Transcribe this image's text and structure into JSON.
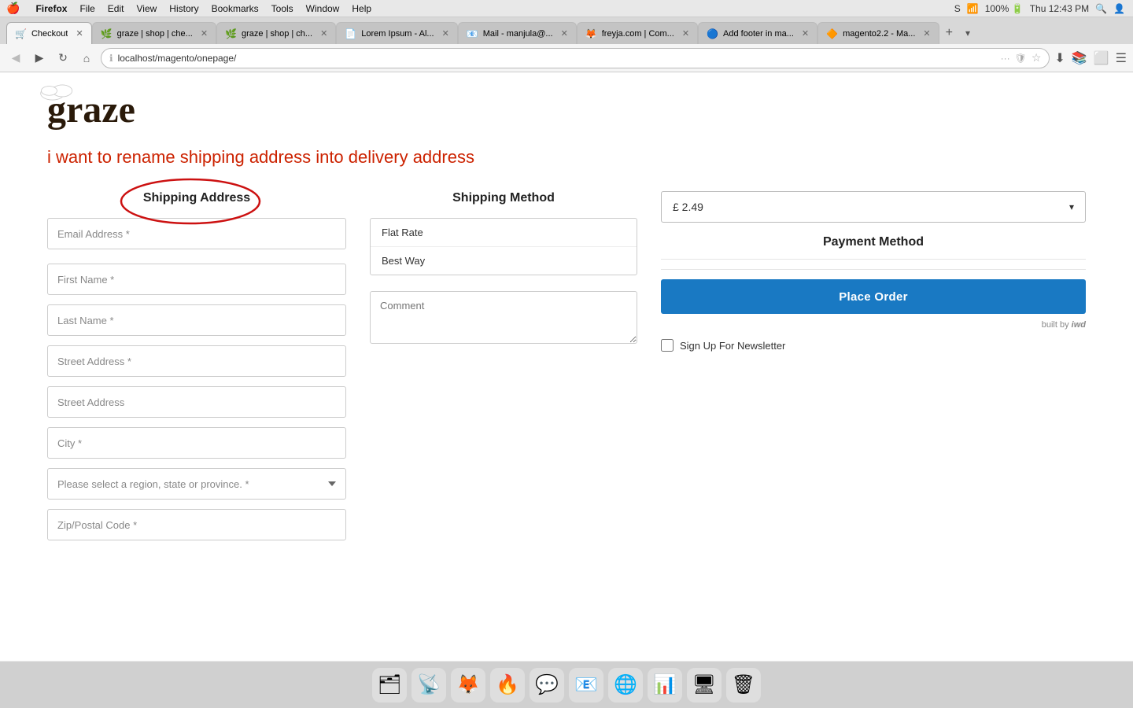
{
  "mac": {
    "apple": "🍎",
    "menu_items": [
      "Firefox",
      "File",
      "Edit",
      "View",
      "History",
      "Bookmarks",
      "Tools",
      "Window",
      "Help"
    ],
    "right_items": [
      "S",
      "100%",
      "🔋",
      "Thu 12:43 PM",
      "🔍",
      "👤"
    ]
  },
  "browser": {
    "tabs": [
      {
        "id": "tab-checkout",
        "label": "Checkout",
        "active": true,
        "favicon": "🛒"
      },
      {
        "id": "tab-graze1",
        "label": "graze | shop | che...",
        "active": false,
        "favicon": "🌿"
      },
      {
        "id": "tab-graze2",
        "label": "graze | shop | ch...",
        "active": false,
        "favicon": "🌿"
      },
      {
        "id": "tab-lorem",
        "label": "Lorem Ipsum - Al...",
        "active": false,
        "favicon": "📄"
      },
      {
        "id": "tab-mail",
        "label": "Mail - manjula@...",
        "active": false,
        "favicon": "📧"
      },
      {
        "id": "tab-freyja",
        "label": "freyja.com | Com...",
        "active": false,
        "favicon": "🦊"
      },
      {
        "id": "tab-footer",
        "label": "Add footer in ma...",
        "active": false,
        "favicon": "🔵"
      },
      {
        "id": "tab-magento",
        "label": "magento2.2 - Ma...",
        "active": false,
        "favicon": "🔶"
      }
    ],
    "url": "localhost/magento/onepage/"
  },
  "header": {
    "logo_text": "graze"
  },
  "annotation": {
    "text": "i want to rename shipping address into delivery address"
  },
  "order_total": {
    "amount": "£ 2.49"
  },
  "shipping_address": {
    "label": "Shipping Address",
    "fields": {
      "email": {
        "placeholder": "Email Address *"
      },
      "first_name": {
        "placeholder": "First Name *"
      },
      "last_name": {
        "placeholder": "Last Name *"
      },
      "street1": {
        "placeholder": "Street Address *"
      },
      "street2": {
        "placeholder": "Street Address"
      },
      "city": {
        "placeholder": "City *"
      },
      "region": {
        "placeholder": "Please select a region, state or province. *"
      },
      "zip": {
        "placeholder": "Zip/Postal Code *"
      }
    }
  },
  "shipping_method": {
    "label": "Shipping Method",
    "methods": [
      {
        "id": "flat_rate",
        "label": "Flat Rate"
      },
      {
        "id": "best_way",
        "label": "Best Way"
      }
    ],
    "comment_placeholder": "Comment"
  },
  "payment_method": {
    "label": "Payment Method"
  },
  "actions": {
    "place_order": "Place Order",
    "built_by": "built by",
    "built_by_brand": "iwd",
    "newsletter_label": "Sign Up For Newsletter"
  },
  "dock_items": [
    "🗂",
    "📡",
    "🦊",
    "🔥",
    "💬",
    "📧",
    "🌐",
    "📊",
    "🖥",
    "🗑"
  ]
}
